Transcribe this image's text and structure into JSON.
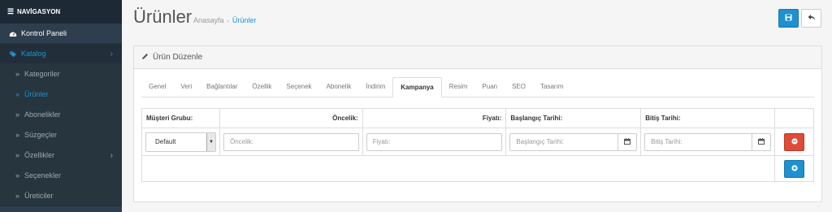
{
  "sidebar": {
    "header": "NAVİGASYON",
    "items": [
      {
        "label": "Kontrol Paneli",
        "icon": "dashboard-icon"
      },
      {
        "label": "Katalog",
        "icon": "tags-icon"
      },
      {
        "label": "Kategoriler"
      },
      {
        "label": "Ürünler"
      },
      {
        "label": "Abonelikler"
      },
      {
        "label": "Süzgeçler"
      },
      {
        "label": "Özellikler"
      },
      {
        "label": "Seçenekler"
      },
      {
        "label": "Üreticiler"
      }
    ]
  },
  "header": {
    "title": "Ürünler",
    "breadcrumb": [
      "Anasayfa",
      "Ürünler"
    ]
  },
  "panel": {
    "title": "Ürün Düzenle",
    "tabs": [
      "Genel",
      "Veri",
      "Bağlantılar",
      "Özellik",
      "Seçenek",
      "Abonelik",
      "İndirim",
      "Kampanya",
      "Resim",
      "Puan",
      "SEO",
      "Tasarım"
    ],
    "active_tab": "Kampanya"
  },
  "table": {
    "headers": [
      "Müşteri Grubu:",
      "Öncelik:",
      "Fiyatı:",
      "Başlangıç Tarihi:",
      "Bitiş Tarihi:"
    ],
    "row": {
      "customer_group": "Default",
      "priority_placeholder": "Öncelik:",
      "price_placeholder": "Fiyatı:",
      "start_placeholder": "Başlangıç Tarihi:",
      "end_placeholder": "Bitiş Tarihi:"
    }
  },
  "colors": {
    "sidebar_bg": "#2e3e4e",
    "accent": "#1e91cf",
    "danger": "#dd4b39"
  }
}
